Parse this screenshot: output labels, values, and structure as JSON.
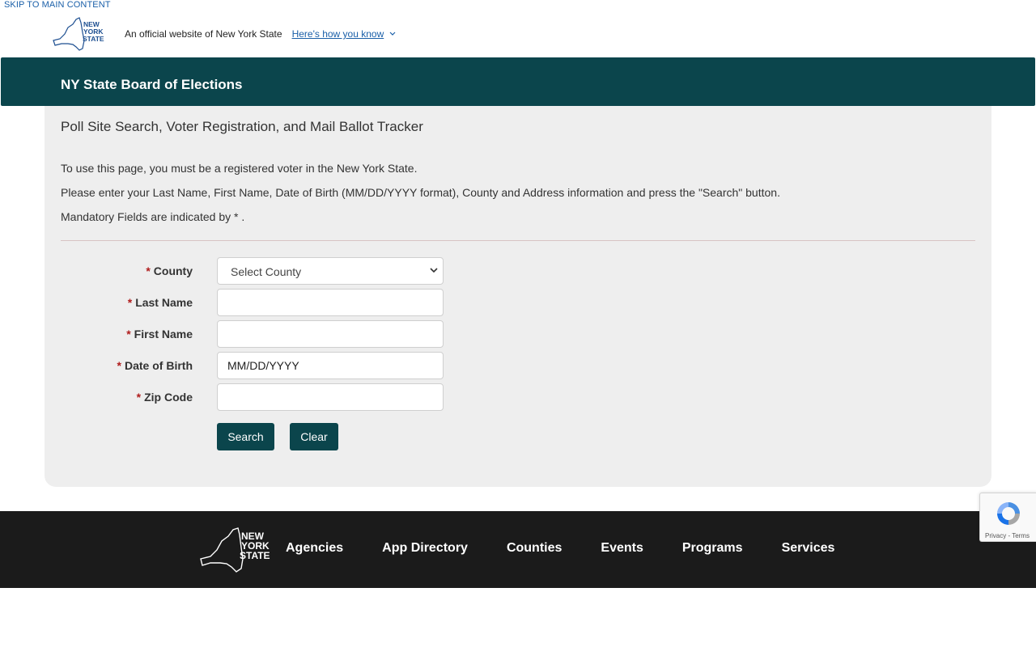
{
  "skip_link": "SKIP TO MAIN CONTENT",
  "universal_nav": {
    "logo_lines": [
      "NEW",
      "YORK",
      "STATE"
    ],
    "official_text": "An official website of New York State",
    "how_you_know": "Here's how you know"
  },
  "agency": {
    "title": "NY State Board of Elections"
  },
  "page": {
    "title": "Poll Site Search, Voter Registration, and Mail Ballot Tracker",
    "intro_1": "To use this page, you must be a registered voter in the New York State.",
    "intro_2": "Please enter your Last Name, First Name, Date of Birth (MM/DD/YYYY format), County and Address information and press the \"Search\" button.",
    "intro_3": "Mandatory Fields are indicated by * ."
  },
  "form": {
    "required_mark": "*",
    "county": {
      "label": "County",
      "selected": "Select County"
    },
    "last_name": {
      "label": "Last Name",
      "value": ""
    },
    "first_name": {
      "label": "First Name",
      "value": ""
    },
    "dob": {
      "label": "Date of Birth",
      "value": "MM/DD/YYYY"
    },
    "zip": {
      "label": "Zip Code",
      "value": ""
    },
    "search_label": "Search",
    "clear_label": "Clear"
  },
  "footer": {
    "logo_lines": [
      "NEW",
      "YORK",
      "STATE"
    ],
    "links": [
      "Agencies",
      "App Directory",
      "Counties",
      "Events",
      "Programs",
      "Services"
    ]
  },
  "recaptcha": {
    "links": "Privacy - Terms"
  },
  "colors": {
    "brand_teal": "#0b454c",
    "footer_bg": "#1b1b1b",
    "link_blue": "#1a5fa8",
    "required_red": "#b01c1c",
    "panel_bg": "#eeeeee"
  }
}
